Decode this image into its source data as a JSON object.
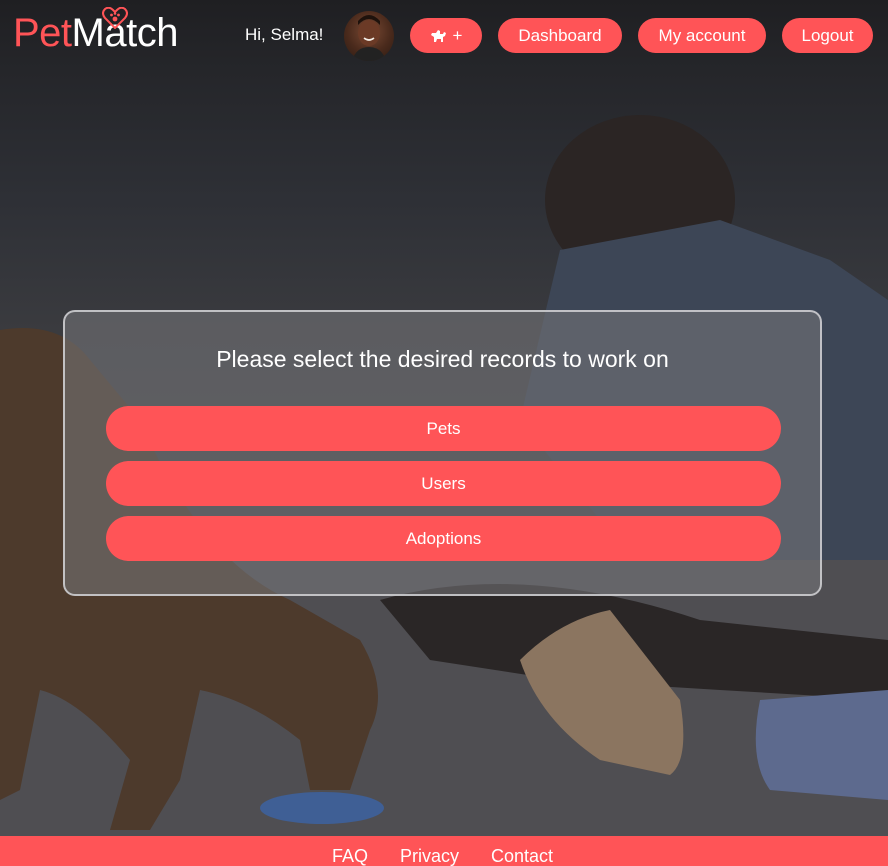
{
  "header": {
    "logo_part1": "Pet",
    "logo_part2": "Match",
    "greeting": "Hi, Selma!",
    "add_pet_plus": "+",
    "nav": {
      "dashboard": "Dashboard",
      "my_account": "My account",
      "logout": "Logout"
    }
  },
  "panel": {
    "title": "Please select the desired records to work on",
    "buttons": {
      "pets": "Pets",
      "users": "Users",
      "adoptions": "Adoptions"
    }
  },
  "footer": {
    "faq": "FAQ",
    "privacy": "Privacy",
    "contact": "Contact"
  },
  "icons": {
    "logo_heart": "paw-heart-icon",
    "add_pet": "dog-icon"
  },
  "colors": {
    "accent": "#ff5457",
    "text": "#ffffff",
    "header_bg": "#1f1f22"
  }
}
